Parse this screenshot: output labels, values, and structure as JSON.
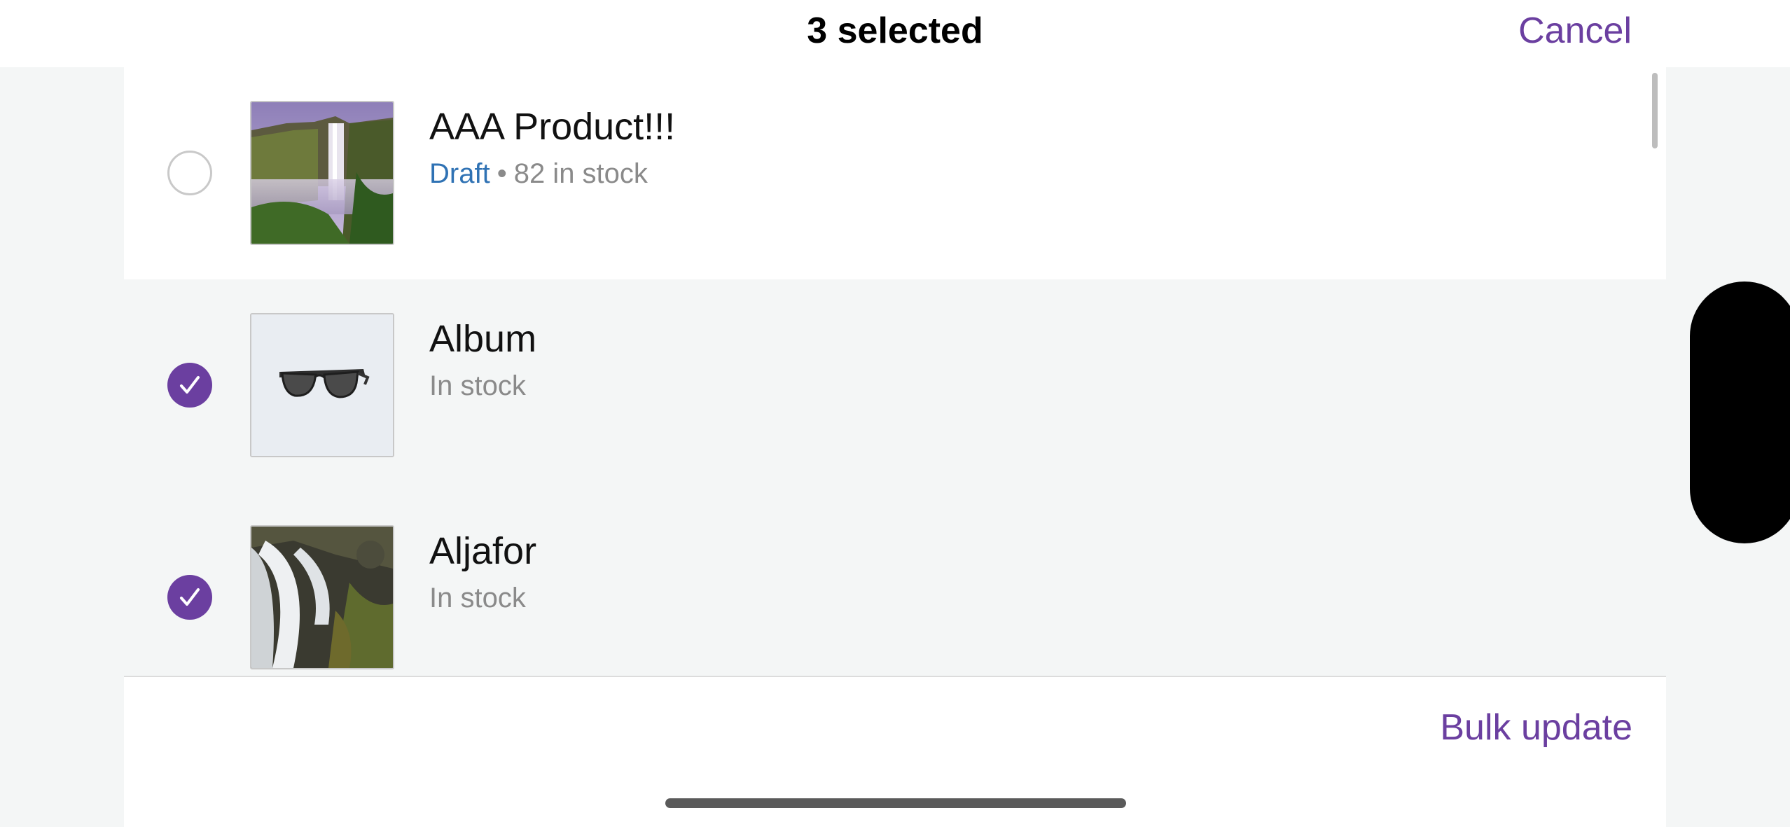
{
  "header": {
    "title": "3 selected",
    "cancel_label": "Cancel"
  },
  "products": [
    {
      "name": "AAA Product!!!",
      "selected": false,
      "status": "Draft",
      "separator": "•",
      "stock": "82 in stock",
      "thumbnail": "waterfall-cliff-image"
    },
    {
      "name": "Album",
      "selected": true,
      "status": "",
      "separator": "",
      "stock": "In stock",
      "thumbnail": "sunglasses-image"
    },
    {
      "name": "Aljafor",
      "selected": true,
      "status": "",
      "separator": "",
      "stock": "In stock",
      "thumbnail": "waterfall-rocks-image"
    }
  ],
  "footer": {
    "bulk_update_label": "Bulk update"
  },
  "colors": {
    "accent": "#6b3fa0",
    "draft": "#2f72b4",
    "secondary_text": "#8a8a8a",
    "selected_row_bg": "#f4f6f6"
  }
}
